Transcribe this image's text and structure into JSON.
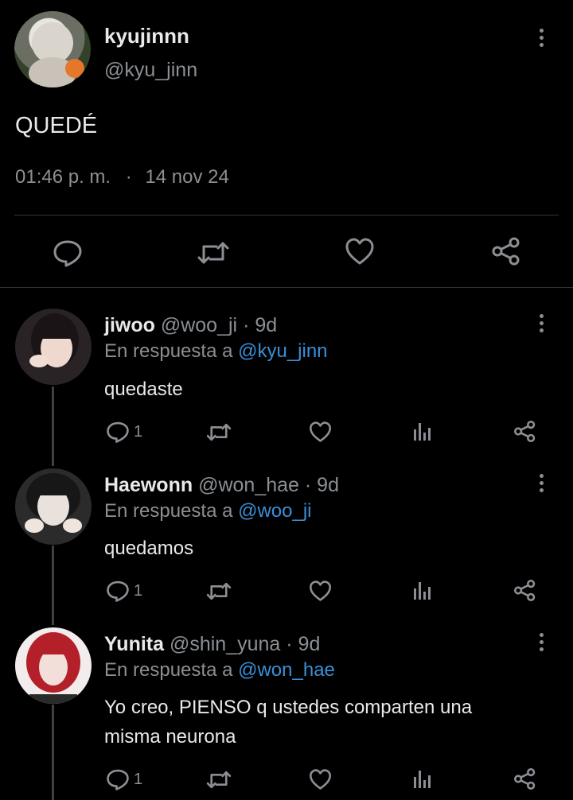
{
  "tweet": {
    "display_name": "kyujinnn",
    "handle": "@kyu_jinn",
    "text": "QUEDÉ",
    "time": "01:46 p. m.",
    "separator": "·",
    "date": "14 nov 24"
  },
  "replies": [
    {
      "display_name": "jiwoo",
      "handle": "@woo_ji",
      "age": "· 9d",
      "reply_prefix": "En respuesta a",
      "reply_to": "@kyu_jinn",
      "text": "quedaste",
      "reply_count": "1"
    },
    {
      "display_name": "Haewonn",
      "handle": "@won_hae",
      "age": "· 9d",
      "reply_prefix": "En respuesta a",
      "reply_to": "@woo_ji",
      "text": "quedamos",
      "reply_count": "1"
    },
    {
      "display_name": "Yunita",
      "handle": "@shin_yuna",
      "age": "· 9d",
      "reply_prefix": "En respuesta a",
      "reply_to": "@won_hae",
      "text_line1": "Yo creo, PIENSO q ustedes comparten una",
      "text_line2": "misma neurona",
      "reply_count": "1"
    }
  ],
  "icons": {
    "reply": "reply-bubble-icon",
    "retweet": "retweet-icon",
    "like": "heart-icon",
    "share": "share-icon",
    "views": "views-bar-chart-icon",
    "more": "more-vertical-icon"
  },
  "colors": {
    "background": "#000000",
    "text": "#e7e9ea",
    "muted": "#8b8f94",
    "link": "#3a8fd8",
    "divider": "#2f3336"
  }
}
